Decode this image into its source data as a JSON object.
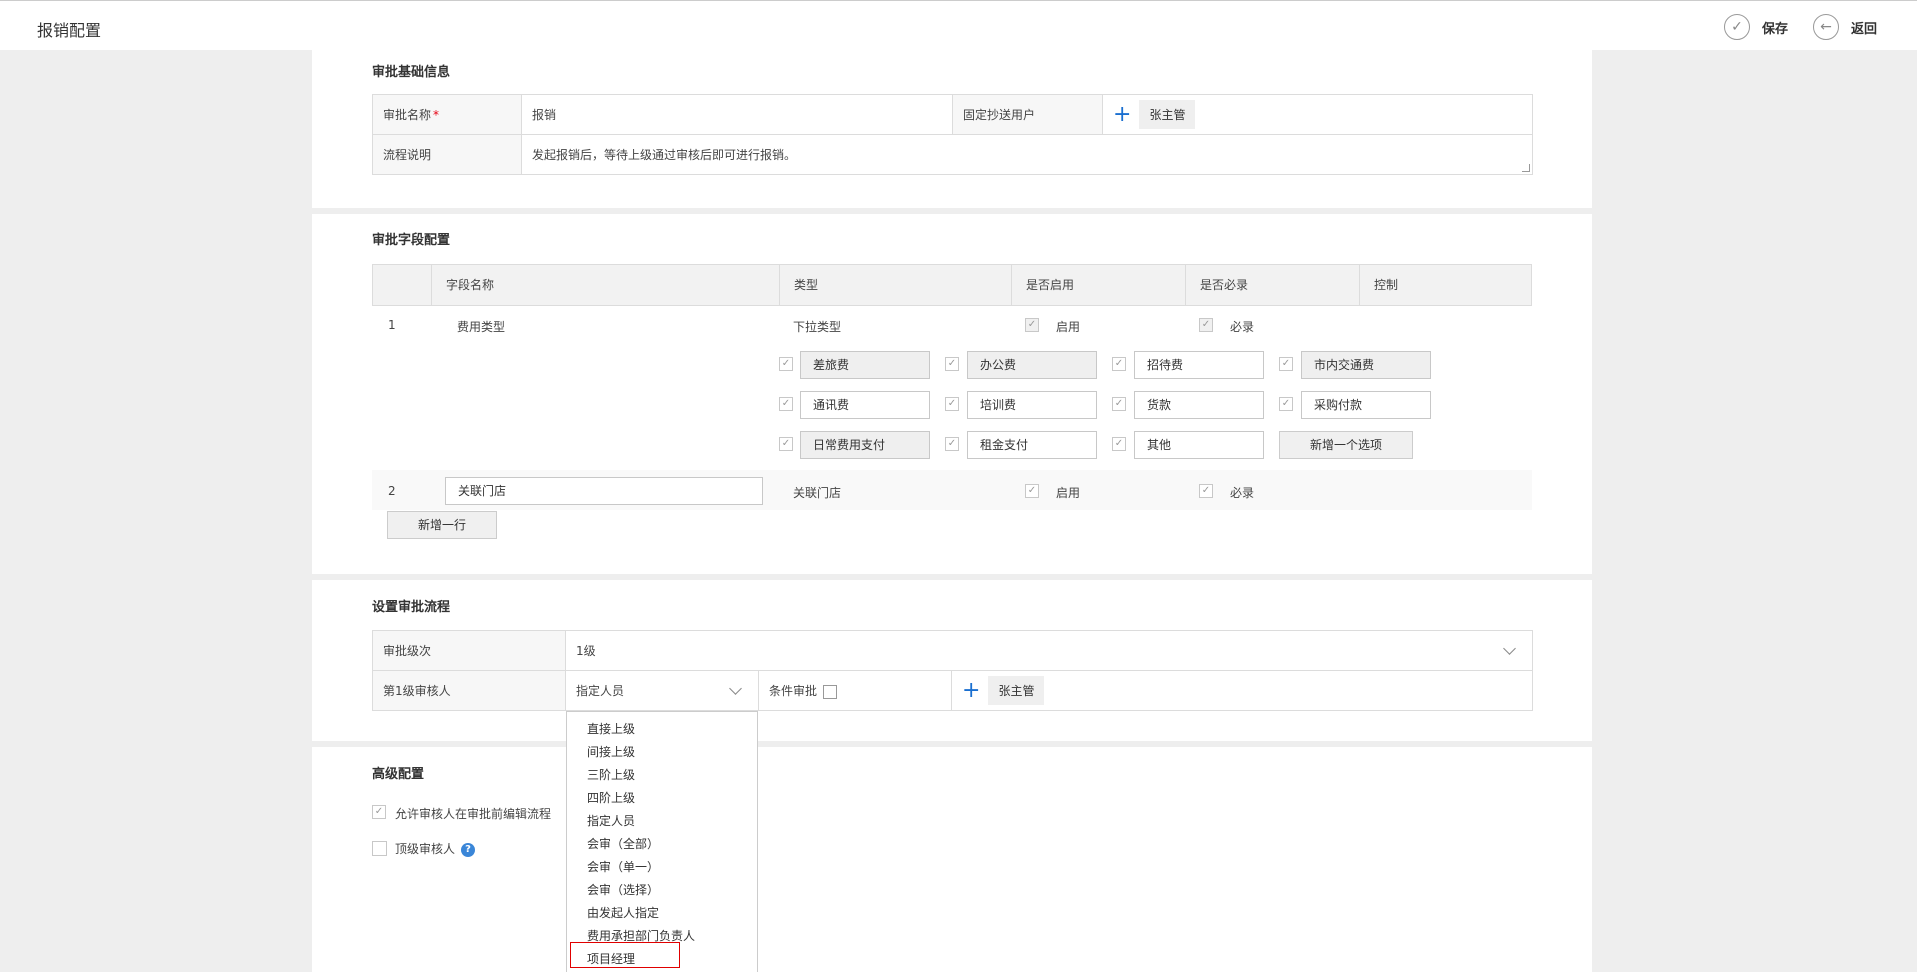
{
  "header": {
    "title": "报销配置",
    "save_label": "保存",
    "back_label": "返回"
  },
  "basic": {
    "section_title": "审批基础信息",
    "name_label": "审批名称",
    "required_mark": "*",
    "name_value": "报销",
    "cc_label": "固定抄送用户",
    "cc_user": "张主管",
    "desc_label": "流程说明",
    "desc_value": "发起报销后，等待上级通过审核后即可进行报销。"
  },
  "fields": {
    "section_title": "审批字段配置",
    "headers": [
      "字段名称",
      "类型",
      "是否启用",
      "是否必录",
      "控制"
    ],
    "row1": {
      "index": "1",
      "name": "费用类型",
      "type": "下拉类型",
      "enabled_label": "启用",
      "required_label": "必录",
      "options": [
        "差旅费",
        "办公费",
        "招待费",
        "市内交通费",
        "通讯费",
        "培训费",
        "货款",
        "采购付款",
        "日常费用支付",
        "租金支付",
        "其他"
      ],
      "add_option_label": "新增一个选项"
    },
    "row2": {
      "index": "2",
      "name": "关联门店",
      "type": "关联门店",
      "enabled_label": "启用",
      "required_label": "必录"
    },
    "add_row_label": "新增一行"
  },
  "flow": {
    "section_title": "设置审批流程",
    "level_label": "审批级次",
    "level_value": "1级",
    "approver_label": "第1级审核人",
    "approver_value": "指定人员",
    "conditional_label": "条件审批",
    "approver_user": "张主管",
    "dropdown_options": [
      "直接上级",
      "间接上级",
      "三阶上级",
      "四阶上级",
      "指定人员",
      "会审（全部）",
      "会审（单一）",
      "会审（选择）",
      "由发起人指定",
      "费用承担部门负责人",
      "项目经理"
    ]
  },
  "advanced": {
    "section_title": "高级配置",
    "allow_edit_label": "允许审核人在审批前编辑流程",
    "top_approver_label": "顶级审核人",
    "help_glyph": "?"
  }
}
